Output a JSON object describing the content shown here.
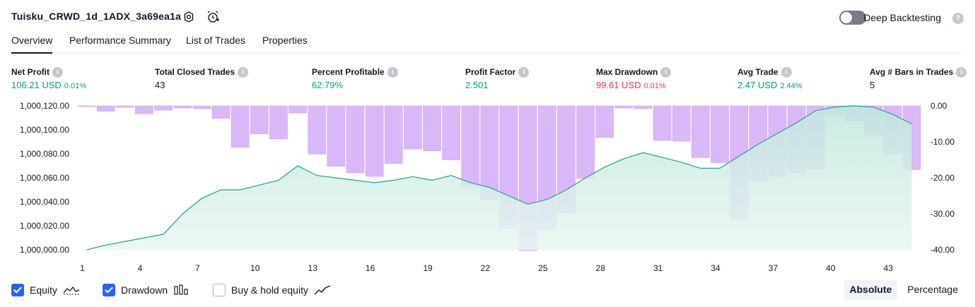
{
  "header": {
    "strategy_name": "Tuisku_CRWD_1d_1ADX_3a69ea1a",
    "settings_icon": "gear-icon",
    "alert_icon": "alarm-clock-plus-icon",
    "deep_backtesting_label": "Deep Backtesting",
    "deep_backtesting_on": false,
    "help_icon": "question-icon"
  },
  "tabs": [
    {
      "label": "Overview",
      "active": true
    },
    {
      "label": "Performance Summary",
      "active": false
    },
    {
      "label": "List of Trades",
      "active": false
    },
    {
      "label": "Properties",
      "active": false
    }
  ],
  "metrics": [
    {
      "label": "Net Profit",
      "value": "106.21 USD",
      "sub": "0.01%",
      "color": "green"
    },
    {
      "label": "Total Closed Trades",
      "value": "43",
      "sub": "",
      "color": "dark"
    },
    {
      "label": "Percent Profitable",
      "value": "62.79%",
      "sub": "",
      "color": "green"
    },
    {
      "label": "Profit Factor",
      "value": "2.501",
      "sub": "",
      "color": "green"
    },
    {
      "label": "Max Drawdown",
      "value": "99.61 USD",
      "sub": "0.01%",
      "color": "red"
    },
    {
      "label": "Avg Trade",
      "value": "2.47 USD",
      "sub": "2.44%",
      "color": "green"
    },
    {
      "label": "Avg # Bars in Trades",
      "value": "5",
      "sub": "",
      "color": "dark"
    }
  ],
  "colors": {
    "green": "#089981",
    "red": "#f23645",
    "equity_line": "#22a08c",
    "equity_fill_top": "#bfe8dc",
    "equity_fill_bottom": "#eaf6f2",
    "drawdown_bar": "#d9b8f8",
    "drawdown_bar_edge": "#c9a6f0",
    "accent": "#2962ff"
  },
  "chart_data": {
    "type": "line",
    "x_ticks": [
      "1",
      "4",
      "7",
      "10",
      "13",
      "16",
      "19",
      "22",
      "25",
      "28",
      "31",
      "34",
      "37",
      "40",
      "43"
    ],
    "y_left_ticks": [
      "1,000,120.00",
      "1,000,100.00",
      "1,000,080.00",
      "1,000,060.00",
      "1,000,040.00",
      "1,000,020.00",
      "1,000,000.00"
    ],
    "y_right_ticks": [
      "0.00",
      "-10.00",
      "-20.00",
      "-30.00",
      "-40.00"
    ],
    "y_left_range": [
      1000000,
      1000120
    ],
    "y_right_range": [
      -40,
      0
    ],
    "x": [
      1,
      2,
      3,
      4,
      5,
      6,
      7,
      8,
      9,
      10,
      11,
      12,
      13,
      14,
      15,
      16,
      17,
      18,
      19,
      20,
      21,
      22,
      23,
      24,
      25,
      26,
      27,
      28,
      29,
      30,
      31,
      32,
      33,
      34,
      35,
      36,
      37,
      38,
      39,
      40,
      41,
      42,
      43,
      44
    ],
    "series": [
      {
        "name": "Equity",
        "kind": "area-line",
        "axis": "left",
        "values": [
          1000000,
          1000004,
          1000007,
          1000010,
          1000013,
          1000030,
          1000043,
          1000050,
          1000050,
          1000054,
          1000058,
          1000070,
          1000062,
          1000060,
          1000058,
          1000056,
          1000058,
          1000061,
          1000058,
          1000062,
          1000056,
          1000052,
          1000045,
          1000038,
          1000042,
          1000050,
          1000060,
          1000069,
          1000076,
          1000081,
          1000077,
          1000073,
          1000068,
          1000068,
          1000078,
          1000088,
          1000097,
          1000106,
          1000116,
          1000119,
          1000120,
          1000119,
          1000113,
          1000105
        ]
      },
      {
        "name": "Drawdown",
        "kind": "bar",
        "axis": "right",
        "values": [
          -0.2,
          -1.5,
          -0.4,
          -2.2,
          -1.2,
          -0.6,
          -0.8,
          -3.5,
          -11.5,
          -7.8,
          -9.2,
          -2,
          -13.4,
          -16.8,
          -18.6,
          -19.6,
          -16,
          -12,
          -12.5,
          -15,
          -22.6,
          -26.2,
          -34,
          -40.2,
          -34.4,
          -29.8,
          -20.2,
          -8.8,
          -0.6,
          -0.8,
          -9.6,
          -9.8,
          -14.4,
          -15.8,
          -31.6,
          -21,
          -19.6,
          -18.6,
          -17.4,
          -2.5,
          -4.3,
          -8,
          -13.4,
          -17.7
        ]
      }
    ],
    "grid": false
  },
  "legend": {
    "items": [
      {
        "label": "Equity",
        "checked": true,
        "icon": "equity-line-icon"
      },
      {
        "label": "Drawdown",
        "checked": true,
        "icon": "drawdown-bars-icon"
      },
      {
        "label": "Buy & hold equity",
        "checked": false,
        "icon": "buy-hold-line-icon"
      }
    ]
  },
  "mode": {
    "options": [
      "Absolute",
      "Percentage"
    ],
    "selected": "Absolute"
  }
}
